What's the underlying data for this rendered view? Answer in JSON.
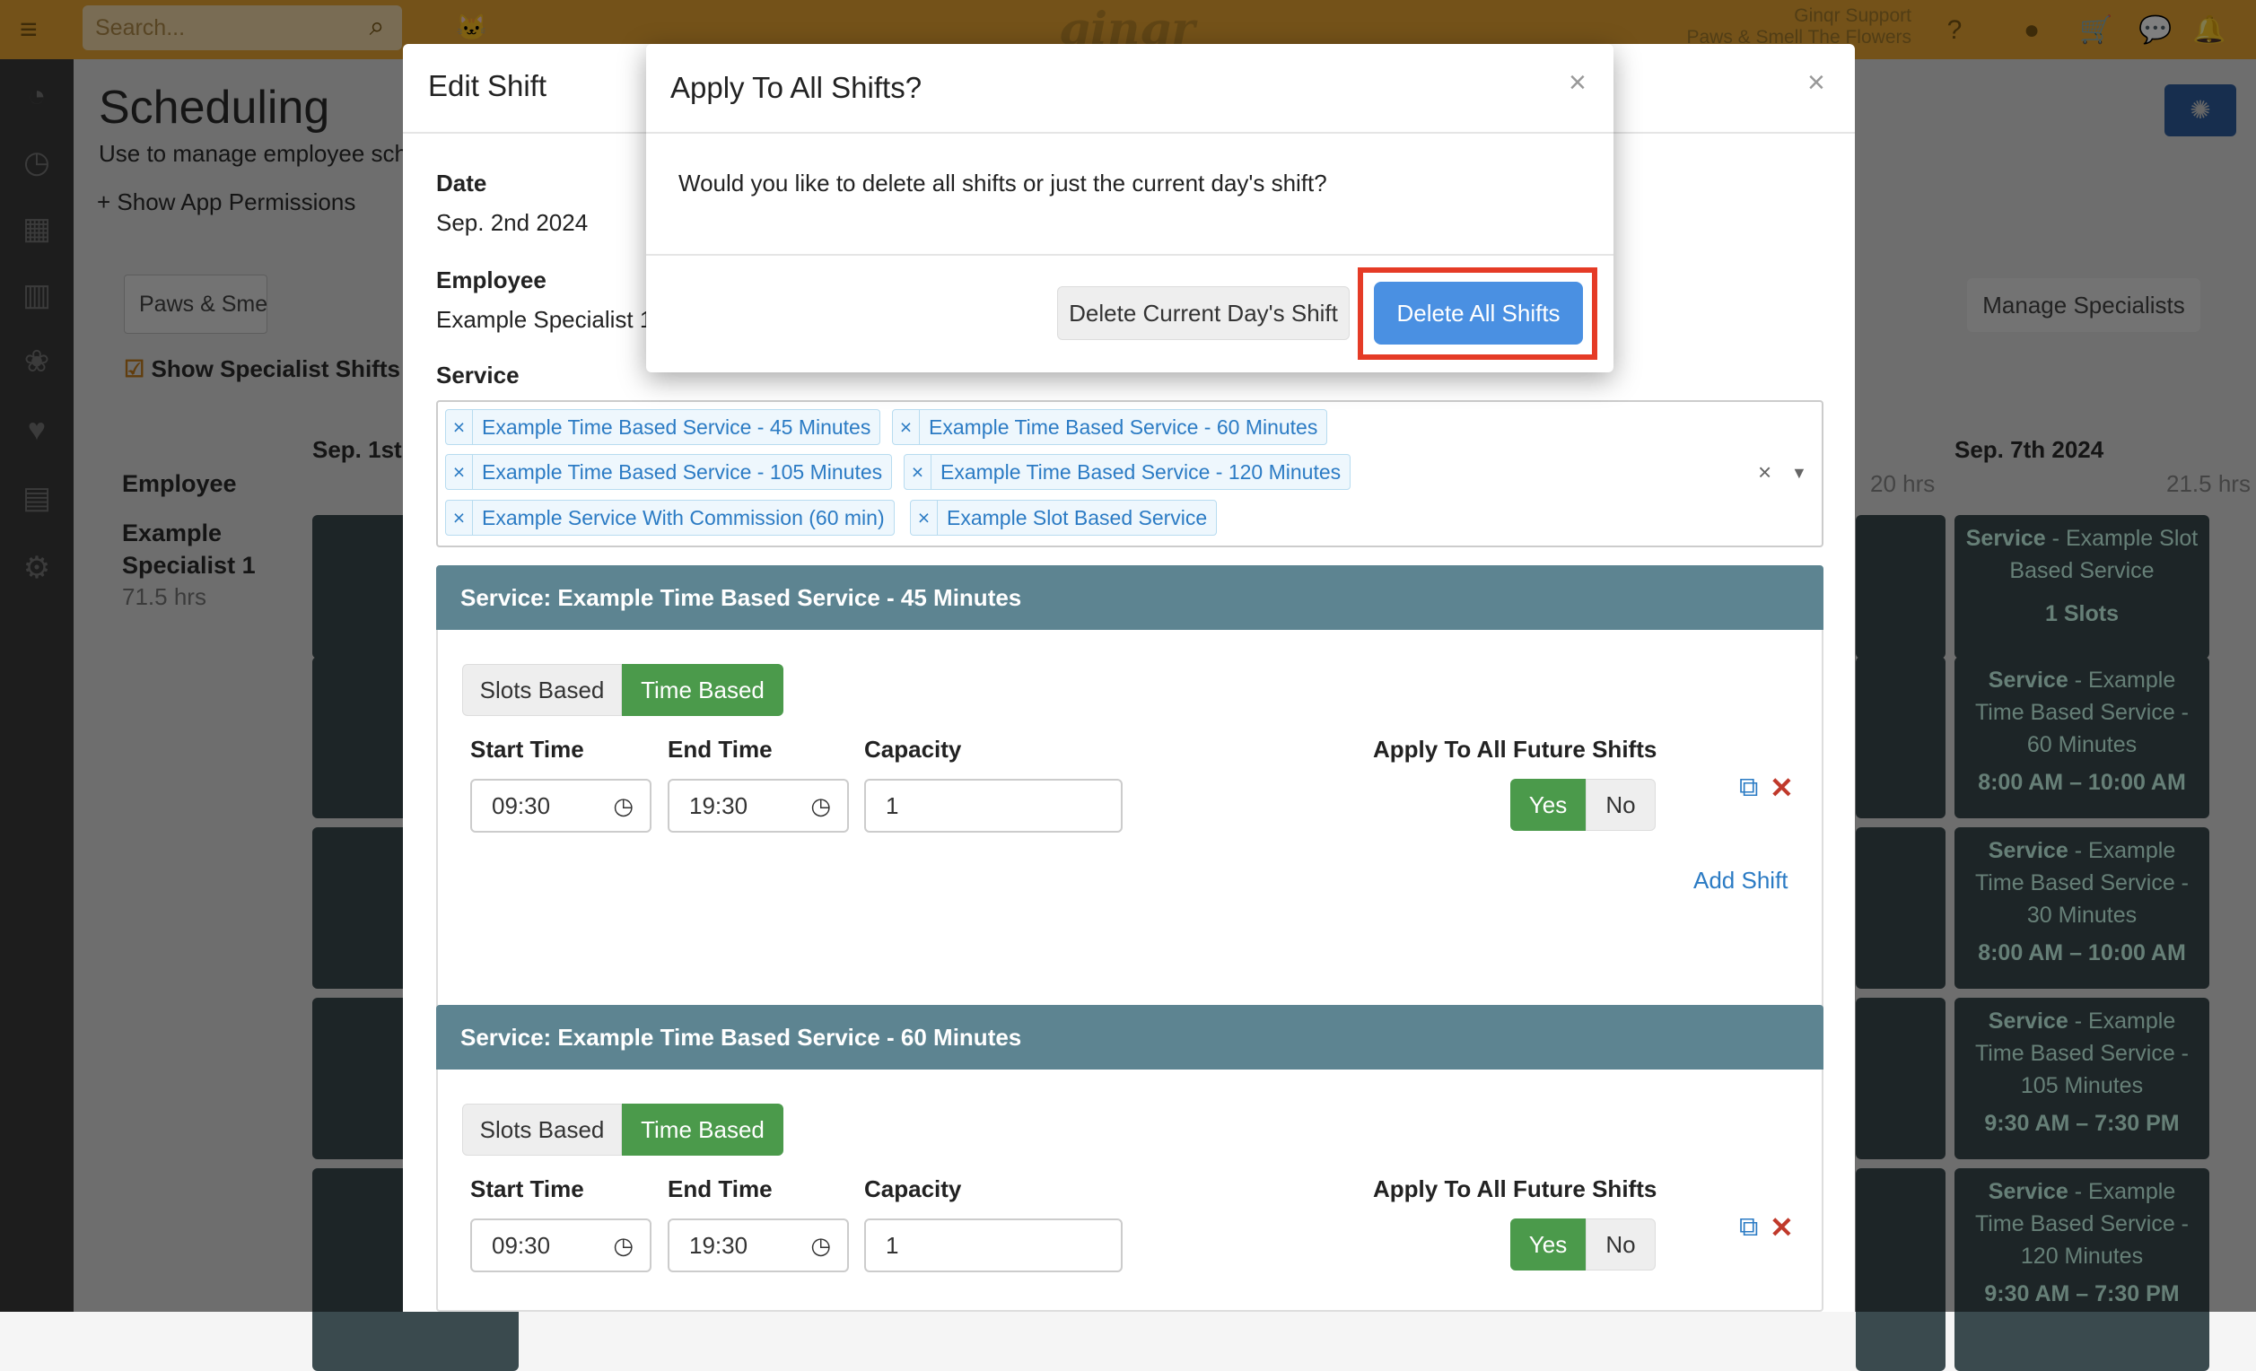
{
  "topbar": {
    "search_placeholder": "Search...",
    "logo": "ginqr",
    "support_name": "Ginqr Support",
    "support_business": "Paws & Smell The Flowers"
  },
  "page": {
    "title": "Scheduling",
    "subtitle": "Use to manage employee sch",
    "permissions_link": "Show App Permissions",
    "location_select": "Paws & Smell The Flowe...",
    "show_specialist_shifts": "Show Specialist Shifts",
    "manage_specialists": "Manage Specialists",
    "employee_header": "Employee",
    "employee_name": "Example Specialist 1",
    "employee_hours": "71.5 hrs",
    "col_sep1": "Sep. 1st",
    "col_sep7": "Sep. 7th 2024",
    "col_sep6_hours": "20 hrs",
    "col_sep7_hours": "21.5 hrs",
    "sep7_cards": [
      {
        "title": "Service",
        "desc": "- Example Slot Based Service",
        "time": "1 Slots"
      },
      {
        "title": "Service",
        "desc": "- Example Time Based Service - 60 Minutes",
        "time": "8:00 AM – 10:00 AM"
      },
      {
        "title": "Service",
        "desc": "- Example Time Based Service - 30 Minutes",
        "time": "8:00 AM – 10:00 AM"
      },
      {
        "title": "Service",
        "desc": "- Example Time Based Service - 105 Minutes",
        "time": "9:30 AM – 7:30 PM"
      },
      {
        "title": "Service",
        "desc": "- Example Time Based Service - 120 Minutes",
        "time": "9:30 AM – 7:30 PM"
      }
    ]
  },
  "edit_modal": {
    "title": "Edit Shift",
    "date_label": "Date",
    "date_value": "Sep. 2nd 2024",
    "employee_label": "Employee",
    "employee_value": "Example Specialist 1",
    "service_label": "Service",
    "service_tags": [
      "Example Time Based Service - 45 Minutes",
      "Example Time Based Service - 60 Minutes",
      "Example Time Based Service - 105 Minutes",
      "Example Time Based Service - 120 Minutes",
      "Example Service With Commission (60 min)",
      "Example Slot Based Service"
    ],
    "sections": [
      {
        "header": "Service: Example Time Based Service - 45 Minutes",
        "slots_label": "Slots Based",
        "time_label": "Time Based",
        "start_label": "Start Time",
        "end_label": "End Time",
        "capacity_label": "Capacity",
        "apply_label": "Apply To All Future Shifts",
        "start_value": "09:30",
        "end_value": "19:30",
        "capacity_value": "1",
        "yes": "Yes",
        "no": "No",
        "add_shift": "Add Shift"
      },
      {
        "header": "Service: Example Time Based Service - 60 Minutes",
        "slots_label": "Slots Based",
        "time_label": "Time Based",
        "start_label": "Start Time",
        "end_label": "End Time",
        "capacity_label": "Capacity",
        "apply_label": "Apply To All Future Shifts",
        "start_value": "09:30",
        "end_value": "19:30",
        "capacity_value": "1",
        "yes": "Yes",
        "no": "No"
      }
    ]
  },
  "confirm_modal": {
    "title": "Apply To All Shifts?",
    "message": "Would you like to delete all shifts or just the current day's shift?",
    "current_button": "Delete Current Day's Shift",
    "all_button": "Delete All Shifts"
  },
  "colors": {
    "topbar": "#e8a533",
    "primary": "#4a90e2",
    "success": "#4b9a4b",
    "section_header": "#5d8491",
    "highlight": "#e53b26"
  }
}
